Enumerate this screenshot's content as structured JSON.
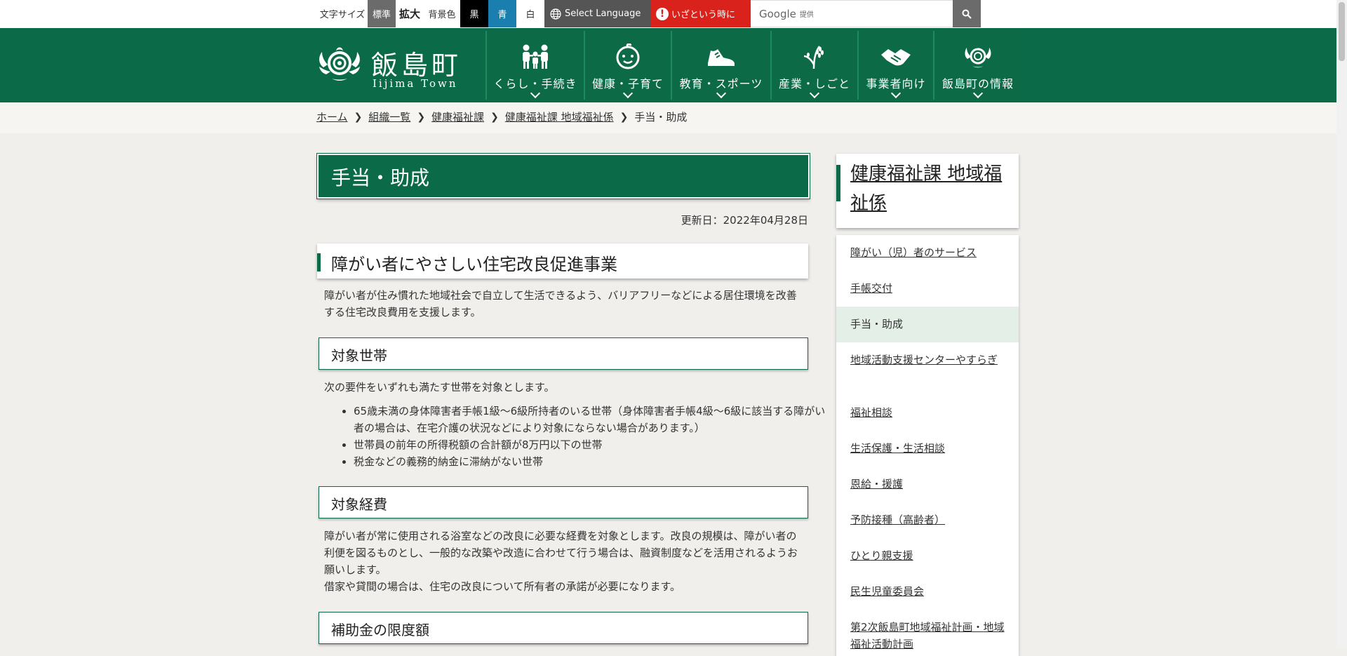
{
  "topbar": {
    "font_size_label": "文字サイズ",
    "font_standard": "標準",
    "font_large": "拡大",
    "bg_label": "背景色",
    "bg_black": "黒",
    "bg_blue": "青",
    "bg_white": "白",
    "select_language": "Select Language",
    "emergency": "いざという時に",
    "google": "Google",
    "google_provided": "提供",
    "search_placeholder": "",
    "colors": {
      "emergency": "#d9221b",
      "blue": "#1a7fae",
      "gray": "#6b6b6b",
      "language": "#555555"
    }
  },
  "header": {
    "logo_title": "飯島町",
    "logo_sub": "Iijima Town",
    "brand_color": "#0b6b48",
    "nav": [
      {
        "label": "くらし・手続き",
        "icon": "family-icon"
      },
      {
        "label": "健康・子育て",
        "icon": "baby-face-icon"
      },
      {
        "label": "教育・スポーツ",
        "icon": "sneaker-icon"
      },
      {
        "label": "産業・しごと",
        "icon": "rice-plant-icon"
      },
      {
        "label": "事業者向け",
        "icon": "handshake-icon"
      },
      {
        "label": "飯島町の情報",
        "icon": "town-emblem-icon"
      }
    ]
  },
  "breadcrumb": [
    "ホーム",
    "組織一覧",
    "健康福祉課",
    "健康福祉課 地域福祉係",
    "手当・助成"
  ],
  "main": {
    "title": "手当・助成",
    "updated": "更新日：2022年04月28日",
    "section_title": "障がい者にやさしい住宅改良促進事業",
    "intro": "障がい者が住み慣れた地域社会で自立して生活できるよう、バリアフリーなどによる居住環境を改善する住宅改良費用を支援します。",
    "target_household": {
      "heading": "対象世帯",
      "lead": "次の要件をいずれも満たす世帯を対象とします。",
      "items": [
        "65歳未満の身体障害者手帳1級～6級所持者のいる世帯（身体障害者手帳4級～6級に該当する障がい者の場合は、在宅介護の状況などにより対象にならない場合があります。）",
        "世帯員の前年の所得税額の合計額が8万円以下の世帯",
        "税金などの義務的納金に滞納がない世帯"
      ]
    },
    "target_cost": {
      "heading": "対象経費",
      "text1": "障がい者が常に使用される浴室などの改良に必要な経費を対象とします。改良の規模は、障がい者の利便を図るものとし、一般的な改築や改造に合わせて行う場合は、融資制度などを活用されるようお願いします。",
      "text2": "借家や貸間の場合は、住宅の改良について所有者の承諾が必要になります。"
    },
    "subsidy_limit": {
      "heading": "補助金の限度額"
    }
  },
  "sidebar": {
    "heading": "健康福祉課 地域福祉係",
    "items": [
      "障がい（児）者のサービス",
      "手帳交付",
      "手当・助成",
      "地域活動支援センターやすらぎ",
      "福祉相談",
      "生活保護・生活相談",
      "恩給・援護",
      "予防接種（高齢者）",
      "ひとり親支援",
      "民生児童委員会",
      "第2次飯島町地域福祉計画・地域福祉活動計画"
    ],
    "current_index": 2
  }
}
